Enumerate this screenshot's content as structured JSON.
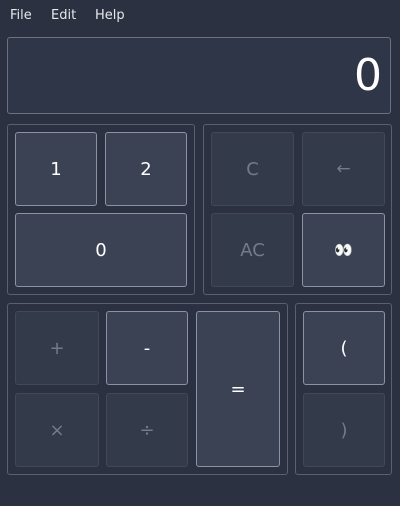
{
  "menu": {
    "file": "File",
    "edit": "Edit",
    "help": "Help"
  },
  "display": {
    "value": "0"
  },
  "digits": {
    "one": "1",
    "two": "2",
    "zero": "0"
  },
  "controls": {
    "clear": "C",
    "backspace": "←",
    "all_clear": "AC",
    "eyes": "👀"
  },
  "operators": {
    "plus": "+",
    "minus": "-",
    "equals": "=",
    "multiply": "×",
    "divide": "÷"
  },
  "parens": {
    "open": "(",
    "close": ")"
  }
}
